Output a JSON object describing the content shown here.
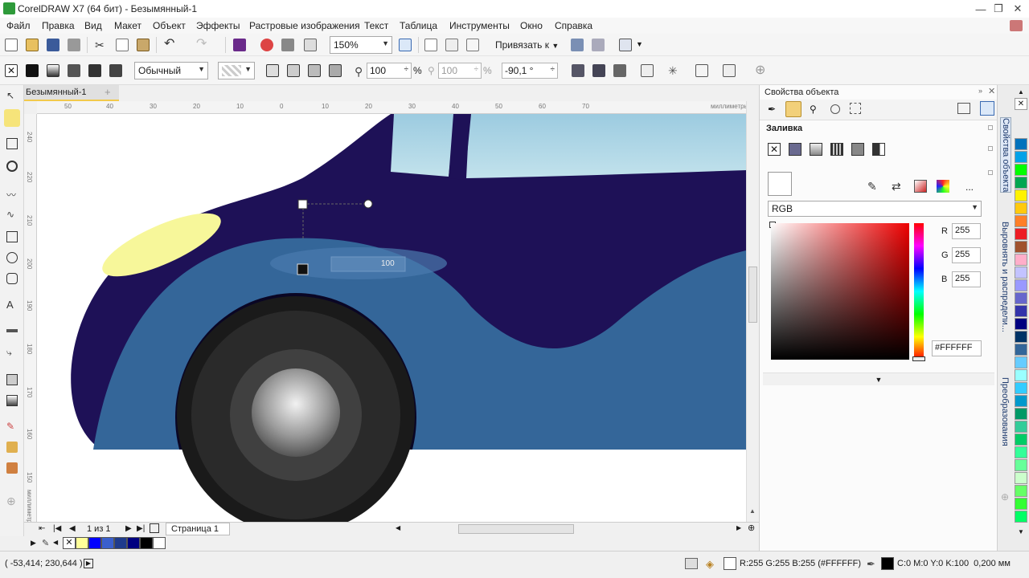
{
  "window": {
    "title": "CorelDRAW X7 (64 бит) - Безымянный-1",
    "min_icon": "minimize-icon",
    "max_icon": "restore-icon",
    "close_icon": "close-icon"
  },
  "menu": [
    "Файл",
    "Правка",
    "Вид",
    "Макет",
    "Объект",
    "Эффекты",
    "Растровые изображения",
    "Текст",
    "Таблица",
    "Инструменты",
    "Окно",
    "Справка"
  ],
  "toolbar": {
    "zoom": "150%",
    "snap_label": "Привязать к"
  },
  "property_bar": {
    "merge_mode": "Обычный",
    "transparency": "100",
    "percent": "%",
    "transparency2": "100",
    "percent2": "%",
    "angle": "-90,1 °"
  },
  "document": {
    "tab": "Безымянный-1",
    "add_tab": "+"
  },
  "rulers": {
    "h_ticks": [
      "50",
      "40",
      "30",
      "20",
      "10",
      "0",
      "10",
      "20",
      "30",
      "40",
      "50",
      "60",
      "70"
    ],
    "h_unit": "миллиметры",
    "v_ticks": [
      "240",
      "220",
      "210",
      "200",
      "190",
      "180",
      "170",
      "160",
      "150"
    ],
    "v_unit": "миллиметры"
  },
  "canvas": {
    "slider_value": "100"
  },
  "nav": {
    "page_count": "1 из 1",
    "page_tab": "Страница 1"
  },
  "status": {
    "coords": "( -53,414; 230,644 )",
    "fill_info": "R:255 G:255 B:255 (#FFFFFF)",
    "outline_info": "C:0 M:0 Y:0 K:100  0,200 мм"
  },
  "docker": {
    "title": "Свойства объекта",
    "section": "Заливка",
    "color_model": "RGB",
    "r_label": "R",
    "r_value": "255",
    "g_label": "G",
    "g_value": "255",
    "b_label": "B",
    "b_value": "255",
    "hex": "#FFFFFF",
    "more": "..."
  },
  "docker_tabs": [
    "Свойства объекта",
    "Выровнять и распредели...",
    "Преобразования"
  ],
  "colors": {
    "car_body": "#1e1157",
    "car_fender": "#346699",
    "tire_dark": "#111111",
    "headlight": "#f7f79a",
    "window": "#a8d2e4",
    "palette": [
      "#ffffff",
      "#000000",
      "#0072bc",
      "#00a2e8",
      "#00ff00",
      "#00a651",
      "#fff200",
      "#ff7f27",
      "#ed1c24",
      "#a0522d",
      "#ffaec9",
      "#c3c3ff",
      "#9999ff",
      "#6666cc",
      "#3333aa",
      "#00007f",
      "#003366",
      "#336699",
      "#66ccff",
      "#99ffff",
      "#ccffcc",
      "#33cc99",
      "#009966",
      "#33ff99",
      "#66ff66"
    ],
    "bottom_swatches": [
      "#ffff99",
      "#0000ff",
      "#3a5fcd",
      "#1f3b8c",
      "#000080",
      "#000000",
      "#ffffff"
    ]
  }
}
